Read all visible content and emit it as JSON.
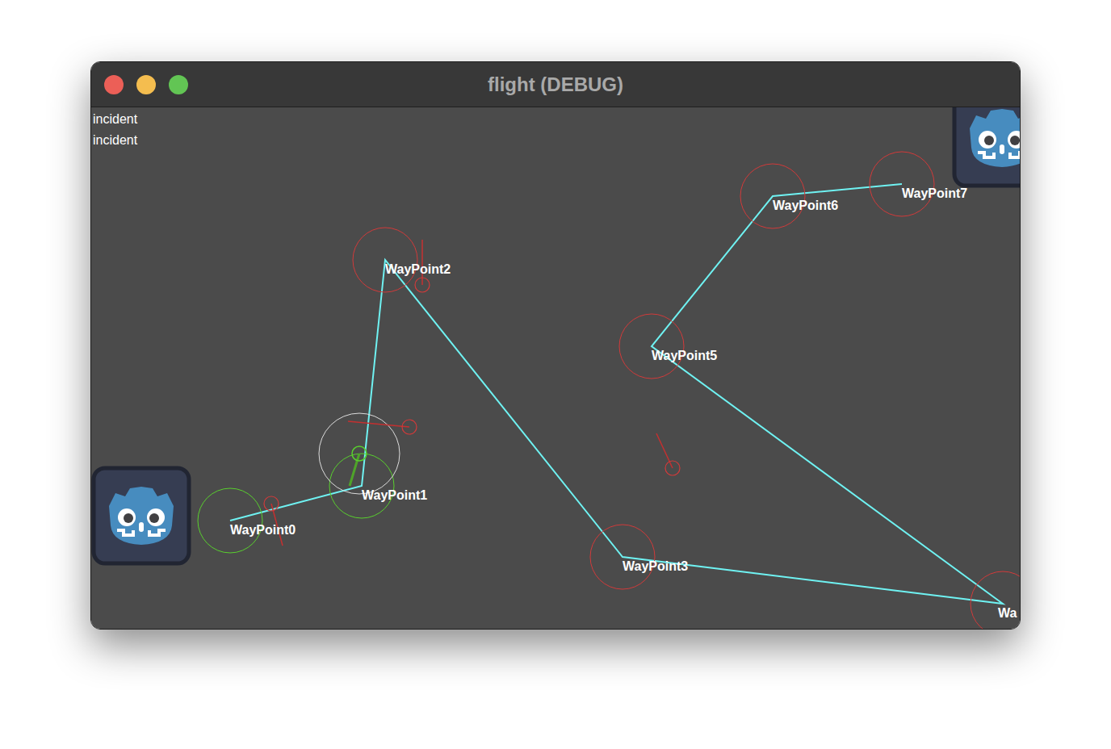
{
  "window": {
    "title": "flight (DEBUG)"
  },
  "log": [
    "incident",
    "incident"
  ],
  "waypoints": [
    {
      "label": "WayPoint0",
      "reached": true
    },
    {
      "label": "WayPoint1",
      "reached": true
    },
    {
      "label": "WayPoint2",
      "reached": false
    },
    {
      "label": "WayPoint3",
      "reached": false
    },
    {
      "label": "Wa",
      "reached": false
    },
    {
      "label": "WayPoint5",
      "reached": false
    },
    {
      "label": "WayPoint6",
      "reached": false
    },
    {
      "label": "WayPoint7",
      "reached": false
    }
  ]
}
